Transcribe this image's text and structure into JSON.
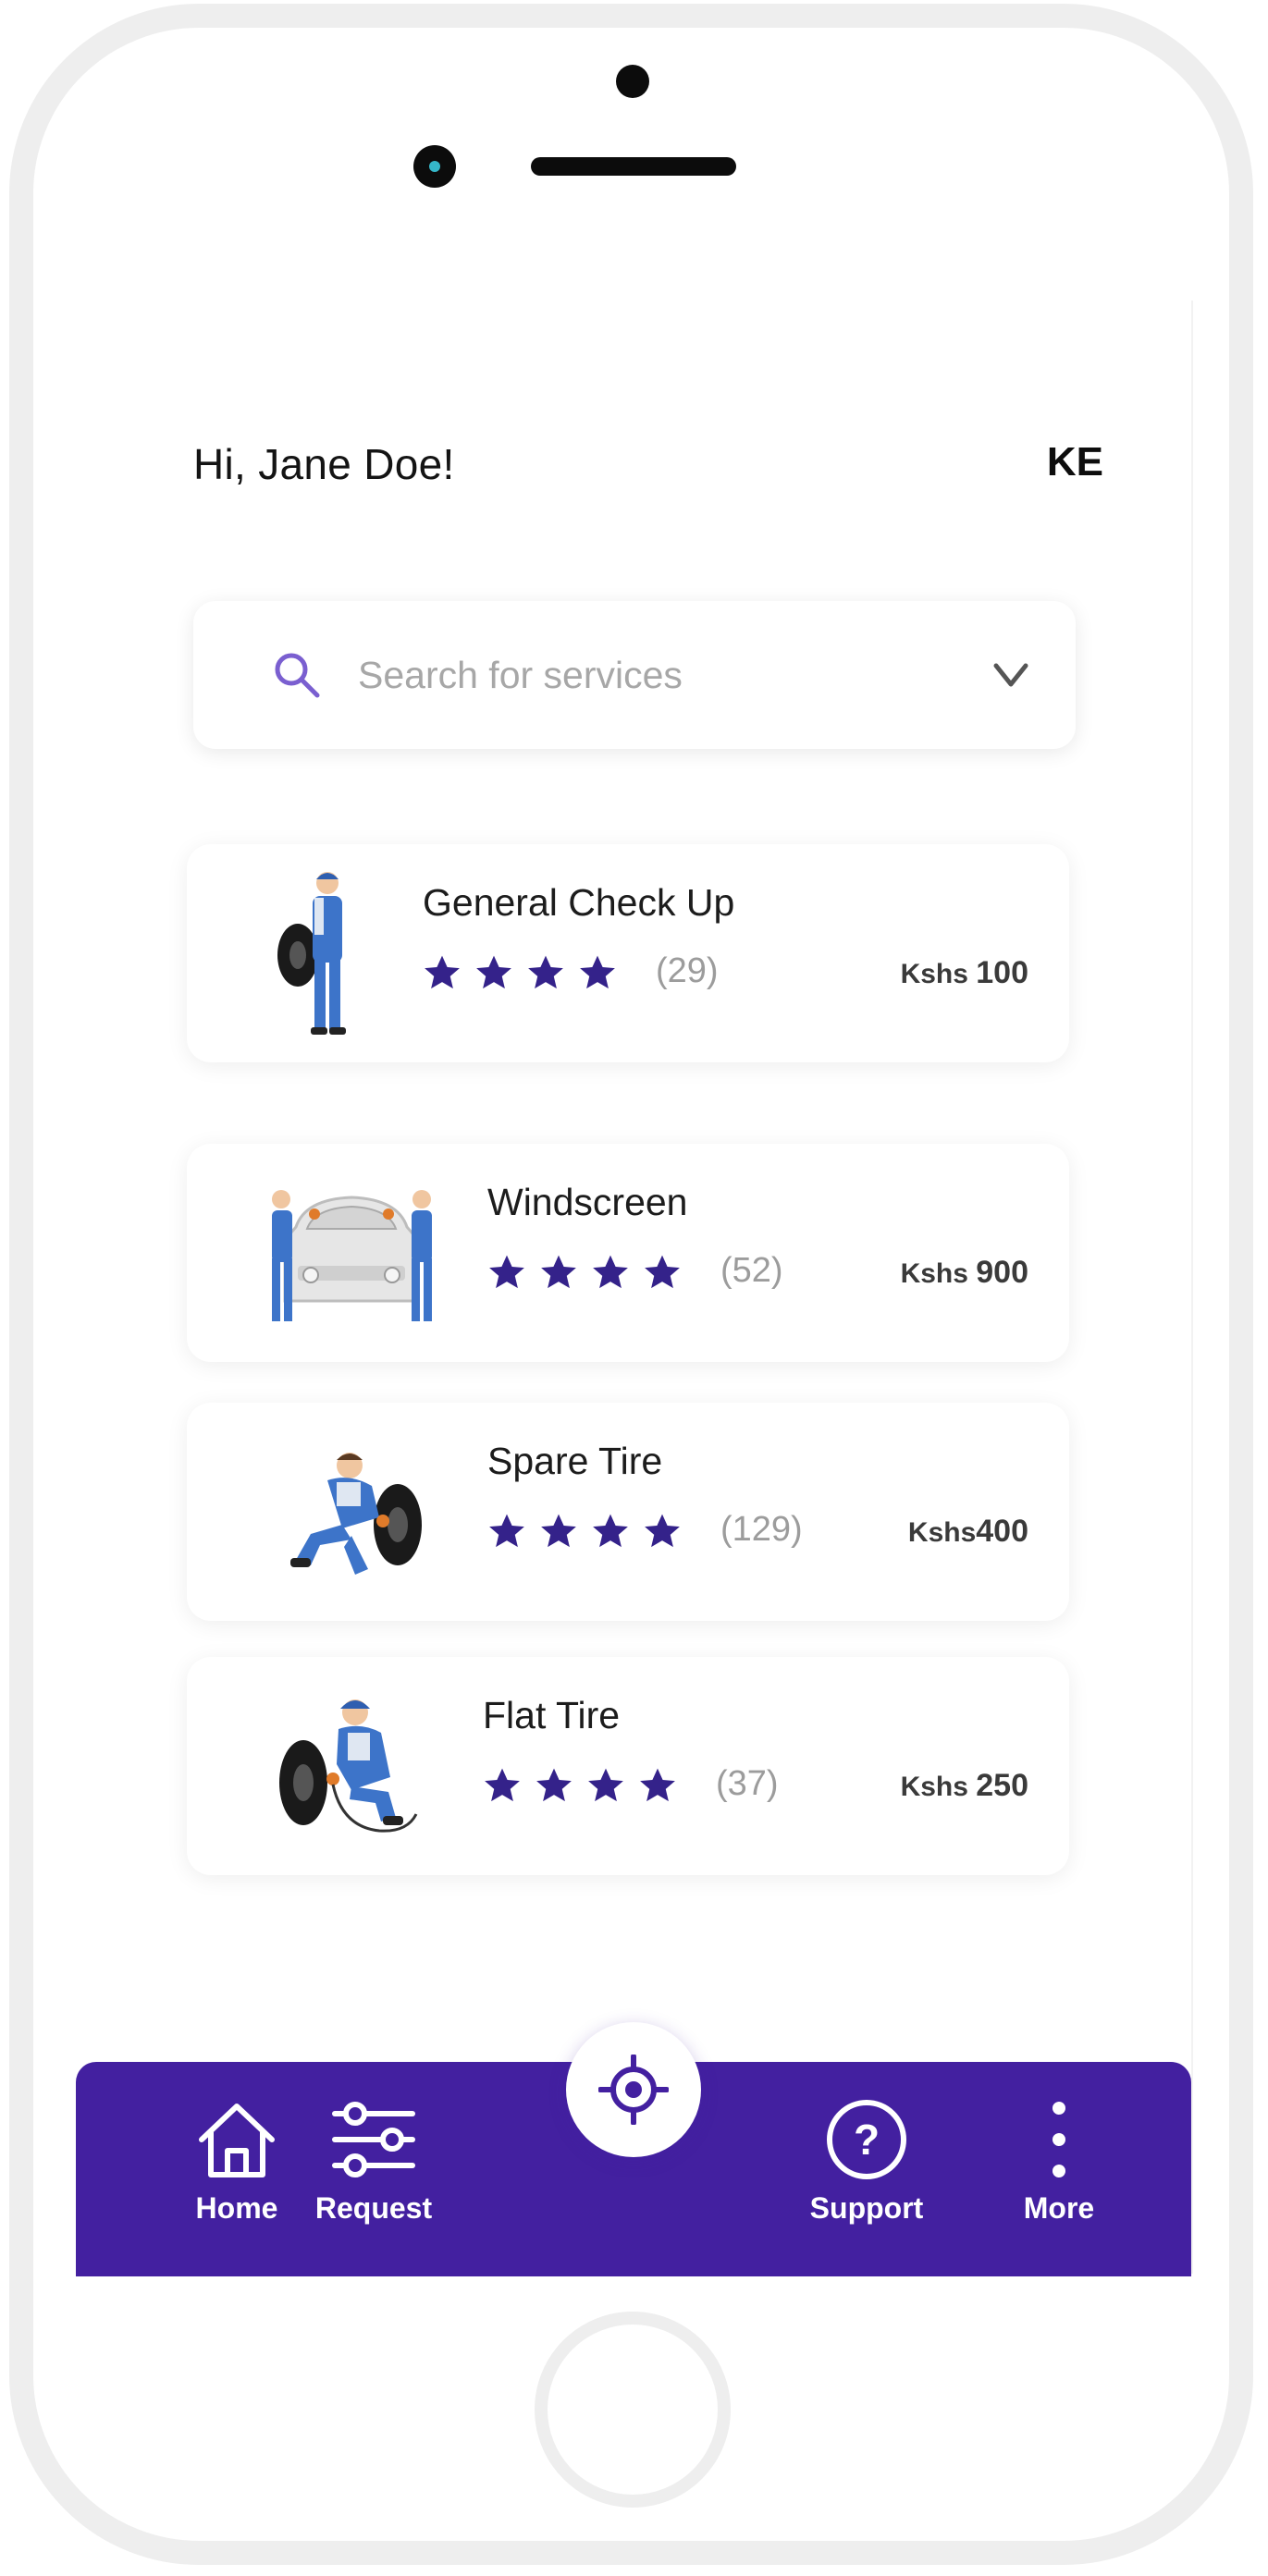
{
  "header": {
    "greeting": "Hi, Jane Doe!",
    "country_code": "KE"
  },
  "search": {
    "placeholder": "Search for services",
    "value": ""
  },
  "services": [
    {
      "title": "General Check Up",
      "rating_stars": 4,
      "reviews": "(29)",
      "currency": "Kshs ",
      "price": "100",
      "illustration": "mechanic-with-tire"
    },
    {
      "title": "Windscreen",
      "rating_stars": 4,
      "reviews": "(52)",
      "currency": "Kshs ",
      "price": "900",
      "illustration": "mechanics-with-car"
    },
    {
      "title": "Spare Tire",
      "rating_stars": 4,
      "reviews": "(129)",
      "currency": "Kshs",
      "price": "400",
      "illustration": "mechanic-kneeling-with-tire"
    },
    {
      "title": "Flat Tire",
      "rating_stars": 4,
      "reviews": "(37)",
      "currency": "Kshs ",
      "price": "250",
      "illustration": "mechanic-inflating-tire"
    }
  ],
  "bottom_nav": {
    "items": [
      {
        "label": "Home",
        "icon": "home-icon"
      },
      {
        "label": "Request",
        "icon": "sliders-icon"
      },
      {
        "label": "Support",
        "icon": "help-circle-icon"
      },
      {
        "label": "More",
        "icon": "more-vertical-icon"
      }
    ],
    "fab_icon": "locate-target-icon"
  },
  "colors": {
    "primary": "#4320a0",
    "star": "#34228a",
    "search_icon": "#7a5fd0",
    "text_muted": "#a7a7a7"
  }
}
